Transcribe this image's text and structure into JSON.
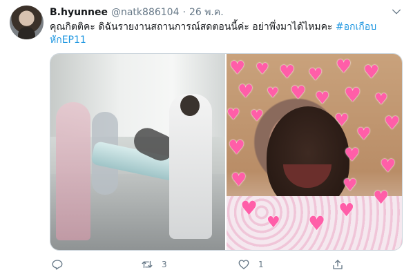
{
  "tweet": {
    "display_name": "B.hyunnee",
    "handle": "@natk886104",
    "separator": "·",
    "date": "26 พ.ค.",
    "text_line1_plain": "คุณกิตติคะ ดิฉันรายงานสถานการณ์สดตอนนี้ค่ะ อย่าพึ่งมาได้ไหมคะ ",
    "text_line1_hashtag": "#อกเกือบ",
    "text_line2_hashtag": "หักEP11",
    "media": [
      {
        "description": "left-photo-hospital-stretcher"
      },
      {
        "description": "right-photo-crying-man-hearts"
      }
    ],
    "actions": {
      "reply_icon": "reply-icon",
      "retweet_icon": "retweet-icon",
      "retweet_count": "3",
      "like_icon": "like-icon",
      "like_count": "1",
      "share_icon": "share-icon"
    },
    "colors": {
      "hashtag": "#1b95e0",
      "secondary_text": "#657786",
      "heart": "#ff5ea8"
    }
  }
}
